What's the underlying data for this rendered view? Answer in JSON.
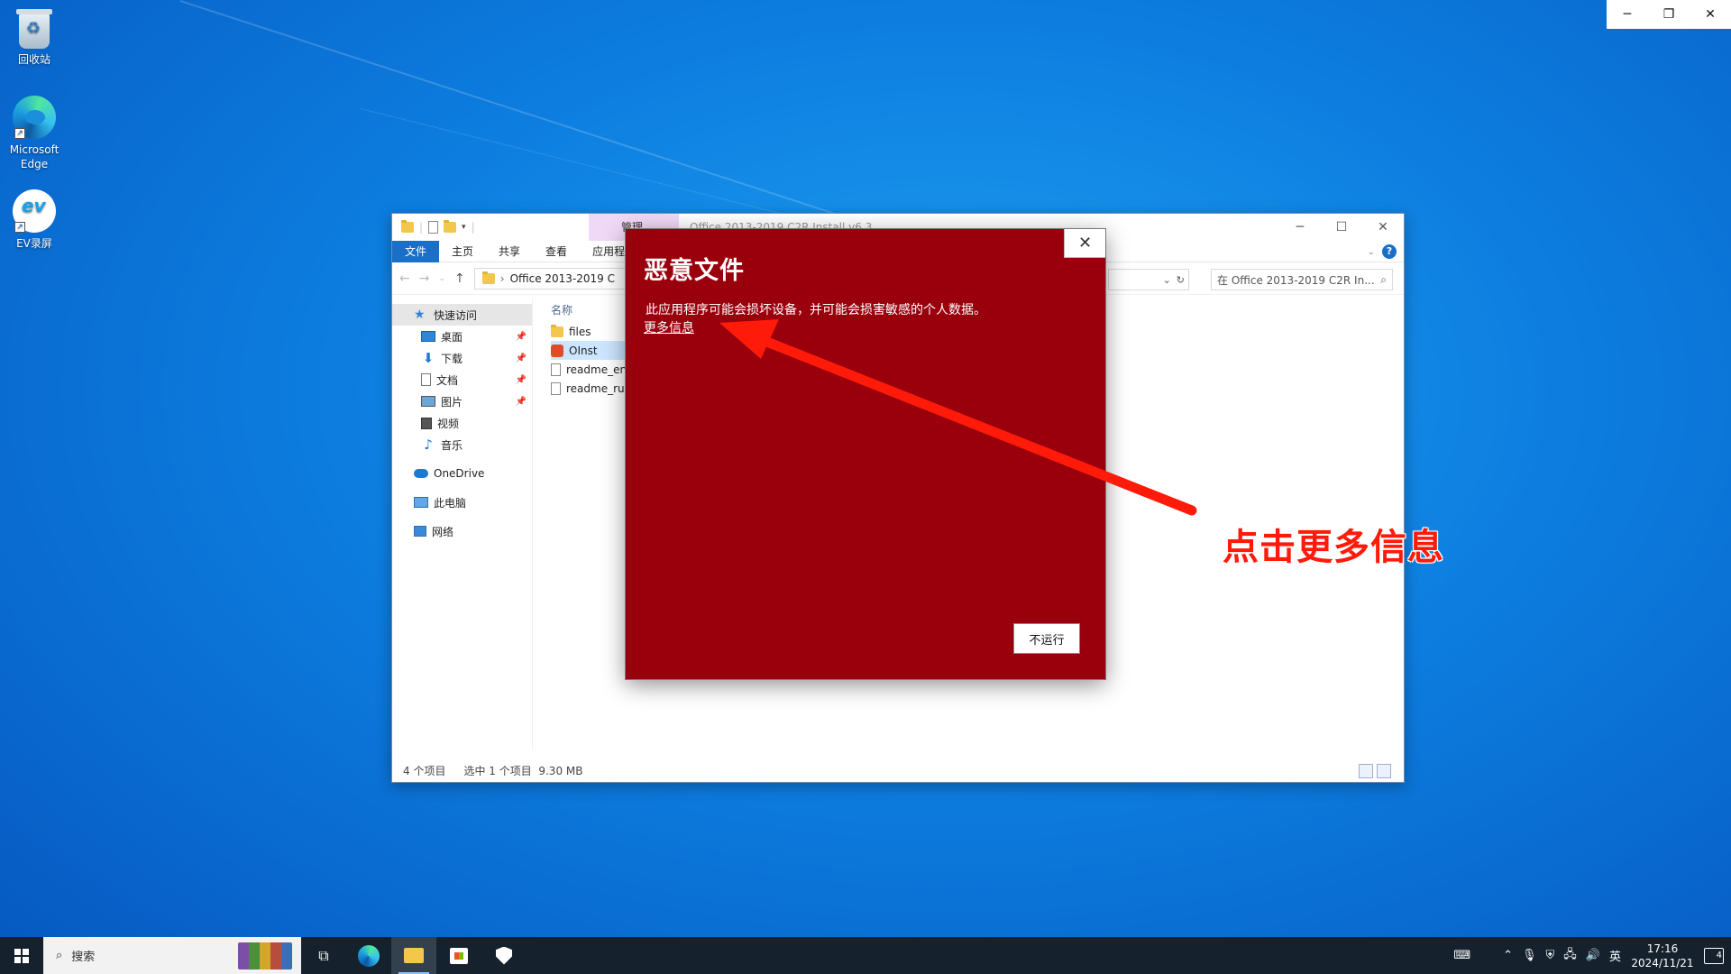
{
  "desktop": {
    "icons": [
      {
        "label": "回收站"
      },
      {
        "label": "Microsoft Edge"
      },
      {
        "label": "EV录屏"
      }
    ]
  },
  "explorer": {
    "manage_tab": "管理",
    "title": "Office 2013-2019 C2R Install v6.3",
    "ribbon_tabs": [
      "文件",
      "主页",
      "共享",
      "查看",
      "应用程序工具"
    ],
    "address": "Office 2013-2019 C",
    "search_placeholder": "在 Office 2013-2019 C2R In...",
    "column_header": "名称",
    "nav": {
      "quick_access": "快速访问",
      "desktop": "桌面",
      "downloads": "下载",
      "documents": "文档",
      "pictures": "图片",
      "videos": "视频",
      "music": "音乐",
      "onedrive": "OneDrive",
      "this_pc": "此电脑",
      "network": "网络"
    },
    "files": [
      "files",
      "OInst",
      "readme_en",
      "readme_ru"
    ],
    "status": {
      "count": "4 个项目",
      "selected": "选中 1 个项目",
      "size": "9.30 MB"
    }
  },
  "dialog": {
    "title": "恶意文件",
    "message": "此应用程序可能会损坏设备，并可能会损害敏感的个人数据。",
    "link": "更多信息",
    "button": "不运行"
  },
  "annotation": {
    "text": "点击更多信息",
    "color": "#ff1a0a"
  },
  "taskbar": {
    "search_label": "搜索",
    "ime": "英",
    "time": "17:16",
    "date": "2024/11/21",
    "notifications": "4"
  }
}
